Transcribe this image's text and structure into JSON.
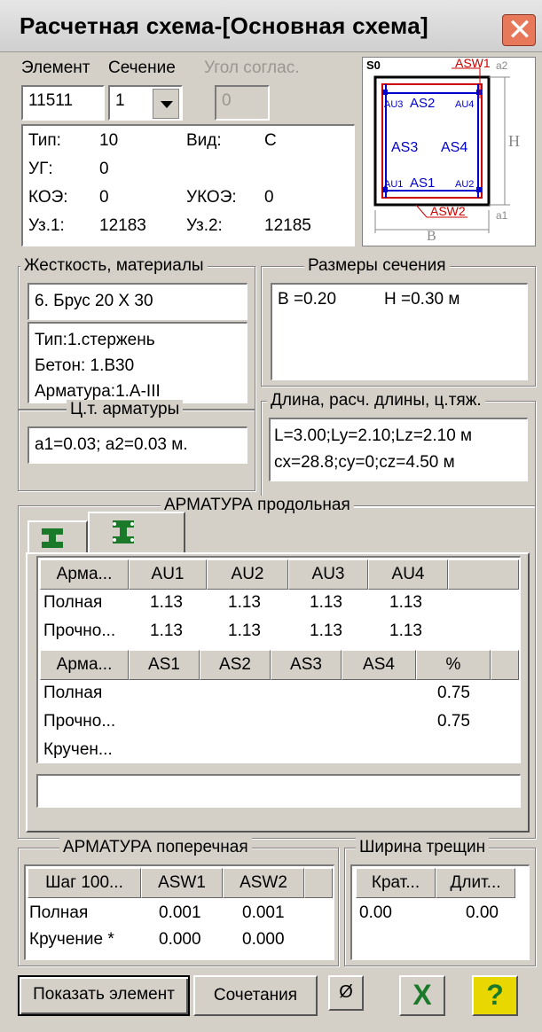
{
  "window": {
    "title": "Расчетная схема-[Основная схема]",
    "close_glyph": "✕"
  },
  "element": {
    "element_label": "Элемент",
    "element_value": "11511",
    "section_label": "Сечение",
    "section_value": "1",
    "angle_label": "Угол соглас.",
    "angle_value": "0"
  },
  "info": {
    "rows": [
      {
        "k1": "Тип:",
        "v1": "10",
        "k2": "Вид:",
        "v2": "С"
      },
      {
        "k1": "УГ:",
        "v1": "0",
        "k2": "",
        "v2": ""
      },
      {
        "k1": "КОЭ:",
        "v1": "0",
        "k2": "УКОЭ:",
        "v2": "0"
      },
      {
        "k1": "Уз.1:",
        "v1": "12183",
        "k2": "Уз.2:",
        "v2": "12185"
      }
    ]
  },
  "schema": {
    "s0": "S0",
    "asw1": "ASW1",
    "a2": "a2",
    "au3": "AU3",
    "as2": "AS2",
    "au4": "AU4",
    "as3": "AS3",
    "as4": "AS4",
    "h": "H",
    "au1": "AU1",
    "as1": "AS1",
    "au2": "AU2",
    "asw2": "ASW2",
    "a1": "a1",
    "b": "B"
  },
  "stiffness": {
    "title": "Жесткость, материалы",
    "type_value": "6. Брус 20 Х 30",
    "lines": [
      "Тип:1.стержень",
      "Бетон: 1.В30",
      "Арматура:1.А-III"
    ]
  },
  "section_size": {
    "title": "Размеры сечения",
    "b": "B =0.20",
    "h": "H =0.30 м"
  },
  "centroid": {
    "title": "Ц.т. арматуры",
    "value": "a1=0.03; a2=0.03 м."
  },
  "length": {
    "title": "Длина, расч. длины, ц.тяж.",
    "line1": "L=3.00;Ly=2.10;Lz=2.10 м",
    "line2": "cx=28.8;cy=0;cz=4.50 м"
  },
  "long_rebar": {
    "title": "АРМАТУРА продольная",
    "table1": {
      "headers": [
        "Арма...",
        "AU1",
        "AU2",
        "AU3",
        "AU4"
      ],
      "rows": [
        [
          "Полная",
          "1.13",
          "1.13",
          "1.13",
          "1.13"
        ],
        [
          "Прочно...",
          "1.13",
          "1.13",
          "1.13",
          "1.13"
        ]
      ]
    },
    "table2": {
      "headers": [
        "Арма...",
        "AS1",
        "AS2",
        "AS3",
        "AS4",
        "%"
      ],
      "rows": [
        [
          "Полная",
          "0.75"
        ],
        [
          "Прочно...",
          "0.75"
        ],
        [
          "Кручен...",
          ""
        ]
      ]
    },
    "footer_value": ""
  },
  "trans_rebar": {
    "title": "АРМАТУРА поперечная",
    "headers": [
      "Шаг 100...",
      "ASW1",
      "ASW2"
    ],
    "rows": [
      [
        "Полная",
        "0.001",
        "0.001"
      ],
      [
        "Кручение *",
        "0.000",
        "0.000"
      ]
    ]
  },
  "crack": {
    "title": "Ширина трещин",
    "headers": [
      "Крат...",
      "Длит..."
    ],
    "row": [
      "0.00",
      "0.00"
    ]
  },
  "buttons": {
    "show": "Показать элемент",
    "combos": "Сочетания",
    "diameter": "Ø",
    "excel": "X",
    "help": "?"
  },
  "colors": {
    "accent_red": "#cc0000",
    "accent_blue": "#0000cc",
    "excel_green": "#1a7a2a",
    "help_yellow": "#e8d800"
  }
}
